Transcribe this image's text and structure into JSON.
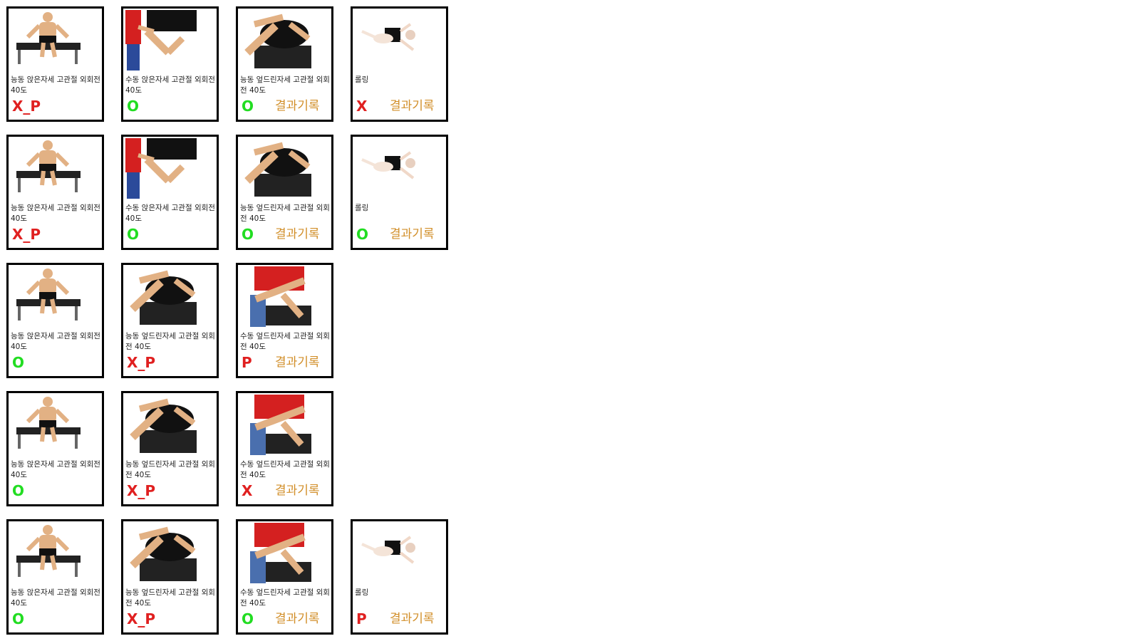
{
  "result_label": "결과기록",
  "rows": [
    [
      {
        "caption": "능동 앉은자세 고관절 외회전 40도",
        "status": "X_P",
        "ok": false,
        "image": "seated-exercise-image",
        "show_result": false
      },
      {
        "caption": "수동 앉은자세 고관절 외회전 40도",
        "status": "O",
        "ok": true,
        "image": "assisted-seated-exercise-image",
        "show_result": false
      },
      {
        "caption": "능동 엎드린자세 고관절 외회전 40도",
        "status": "O",
        "ok": true,
        "image": "prone-exercise-image",
        "show_result": true
      },
      {
        "caption": "롤링",
        "status": "X",
        "ok": false,
        "image": "rolling-exercise-image",
        "show_result": true
      }
    ],
    [
      {
        "caption": "능동 앉은자세 고관절 외회전 40도",
        "status": "X_P",
        "ok": false,
        "image": "seated-exercise-image",
        "show_result": false
      },
      {
        "caption": "수동 앉은자세 고관절 외회전 40도",
        "status": "O",
        "ok": true,
        "image": "assisted-seated-exercise-image",
        "show_result": false
      },
      {
        "caption": "능동 엎드린자세 고관절 외회전 40도",
        "status": "O",
        "ok": true,
        "image": "prone-exercise-image",
        "show_result": true
      },
      {
        "caption": "롤링",
        "status": "O",
        "ok": true,
        "image": "rolling-exercise-image",
        "show_result": true
      }
    ],
    [
      {
        "caption": "능동 앉은자세 고관절 외회전 40도",
        "status": "O",
        "ok": true,
        "image": "seated-exercise-image",
        "show_result": false
      },
      {
        "caption": "능동 엎드린자세 고관절 외회전 40도",
        "status": "X_P",
        "ok": false,
        "image": "prone-exercise-image",
        "show_result": false
      },
      {
        "caption": "수동 엎드린자세 고관절 외회전 40도",
        "status": "P",
        "ok": false,
        "image": "assisted-prone-exercise-image",
        "show_result": true
      },
      null
    ],
    [
      {
        "caption": "능동 앉은자세 고관절 외회전 40도",
        "status": "O",
        "ok": true,
        "image": "seated-exercise-image",
        "show_result": false
      },
      {
        "caption": "능동 엎드린자세 고관절 외회전 40도",
        "status": "X_P",
        "ok": false,
        "image": "prone-exercise-image",
        "show_result": false
      },
      {
        "caption": "수동 엎드린자세 고관절 외회전 40도",
        "status": "X",
        "ok": false,
        "image": "assisted-prone-exercise-image",
        "show_result": true
      },
      null
    ],
    [
      {
        "caption": "능동 앉은자세 고관절 외회전 40도",
        "status": "O",
        "ok": true,
        "image": "seated-exercise-image",
        "show_result": false
      },
      {
        "caption": "능동 엎드린자세 고관절 외회전 40도",
        "status": "X_P",
        "ok": false,
        "image": "prone-exercise-image",
        "show_result": false
      },
      {
        "caption": "수동 엎드린자세 고관절 외회전 40도",
        "status": "O",
        "ok": true,
        "image": "assisted-prone-exercise-image",
        "show_result": true
      },
      {
        "caption": "롤링",
        "status": "P",
        "ok": false,
        "image": "rolling-exercise-image",
        "show_result": true
      }
    ]
  ],
  "colors": {
    "ok": "#22dd22",
    "bad": "#e02020",
    "result": "#d28f2a",
    "border": "#000000"
  }
}
